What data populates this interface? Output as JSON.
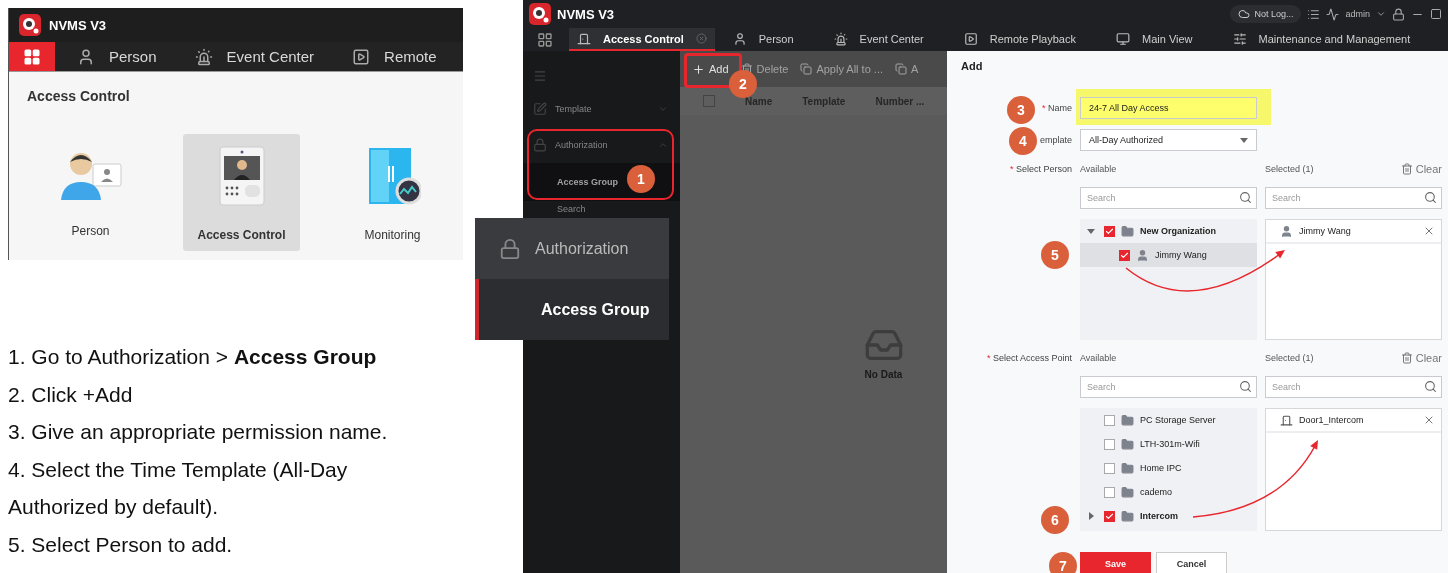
{
  "home_window": {
    "app_title": "NVMS V3",
    "nav": [
      {
        "kind": "home",
        "selected": true
      },
      {
        "kind": "person",
        "label": "Person",
        "selected": false
      },
      {
        "kind": "event",
        "label": "Event Center",
        "selected": false
      },
      {
        "kind": "playback",
        "label": "Remote",
        "selected": false
      }
    ],
    "section_title": "Access Control",
    "tiles": [
      {
        "kind": "person",
        "label": "Person",
        "selected": false
      },
      {
        "kind": "access_control",
        "label": "Access Control",
        "selected": true
      },
      {
        "kind": "monitoring",
        "label": "Monitoring",
        "selected": false
      }
    ]
  },
  "instructions": [
    "1. Go to Authorization > **Access Group**",
    "2. Click +Add",
    "3. Give an appropriate permission name.",
    "4. Select the Time Template (All-Day Authorized by default).",
    "5. Select Person to add."
  ],
  "inset": [
    {
      "kind": "group",
      "label": "Authorization",
      "selected": false
    },
    {
      "kind": "child",
      "label": "Access Group",
      "selected": true
    }
  ],
  "app": {
    "title": "NVMS V3",
    "cloud_status": "Not Log...",
    "user": "admin",
    "tabs": [
      {
        "kind": "access_control",
        "label": "Access Control",
        "selected": true
      },
      {
        "kind": "person",
        "label": "Person",
        "selected": false
      },
      {
        "kind": "event",
        "label": "Event Center",
        "selected": false
      },
      {
        "kind": "playback",
        "label": "Remote Playback",
        "selected": false
      },
      {
        "kind": "main_view",
        "label": "Main View",
        "selected": false
      },
      {
        "kind": "maintenance",
        "label": "Maintenance and Management",
        "selected": false
      }
    ],
    "sidebar": [
      {
        "kind": "template",
        "label": "Template",
        "expanded": false
      },
      {
        "kind": "authorization",
        "label": "Authorization",
        "expanded": true,
        "children": [
          {
            "label": "Access Group",
            "selected": true
          },
          {
            "label": "Search",
            "selected": false
          }
        ]
      }
    ],
    "toolbar": [
      {
        "kind": "add",
        "label": "Add",
        "disabled": false
      },
      {
        "kind": "delete",
        "label": "Delete",
        "disabled": true
      },
      {
        "kind": "apply",
        "label": "Apply All to ...",
        "disabled": true
      },
      {
        "kind": "apply_more",
        "label": "A",
        "disabled": true
      }
    ],
    "table": {
      "all_checked": false,
      "columns": [
        "Name",
        "Template",
        "Number ..."
      ],
      "empty_text": "No Data"
    },
    "form": {
      "title": "Add",
      "fields": [
        {
          "kind": "text",
          "label": "Name",
          "required_mark": "*",
          "value": "24-7 All Day Access",
          "highlighted": true
        },
        {
          "kind": "select",
          "label": "emplate",
          "value": "All-Day Authorized",
          "highlighted": false
        }
      ],
      "pickers": [
        {
          "label": "Select Person",
          "required_mark": "*",
          "available_label": "Available",
          "selected_label": "Selected (1)",
          "clear_label": "Clear",
          "placeholder_available": "Search",
          "placeholder_selected": "Search",
          "available": [
            {
              "kind": "group",
              "label": "New Organization",
              "expanded": true,
              "checked": true,
              "selected": false,
              "children": [
                {
                  "kind": "person",
                  "label": "Jimmy Wang",
                  "checked": true,
                  "selected": true
                }
              ]
            }
          ],
          "selected": [
            {
              "kind": "person",
              "label": "Jimmy Wang"
            }
          ]
        },
        {
          "label": "Select Access Point",
          "required_mark": "*",
          "available_label": "Available",
          "selected_label": "Selected (1)",
          "clear_label": "Clear",
          "placeholder_available": "Search",
          "placeholder_selected": "Search",
          "available": [
            {
              "kind": "folder",
              "label": "PC Storage Server",
              "checked": false,
              "selected": false
            },
            {
              "kind": "folder",
              "label": "LTH-301m-Wifi",
              "checked": false,
              "selected": false
            },
            {
              "kind": "folder",
              "label": "Home IPC",
              "checked": false,
              "selected": false
            },
            {
              "kind": "folder",
              "label": "cademo",
              "checked": false,
              "selected": false
            },
            {
              "kind": "group",
              "label": "Intercom",
              "expanded": false,
              "checked": true,
              "selected": false
            }
          ],
          "selected": [
            {
              "kind": "door",
              "label": "Door1_Intercom"
            }
          ]
        }
      ],
      "buttons": [
        {
          "kind": "primary",
          "label": "Save"
        },
        {
          "kind": "secondary",
          "label": "Cancel"
        }
      ]
    }
  },
  "annotations": [
    "1",
    "2",
    "3",
    "4",
    "5",
    "6",
    "7"
  ]
}
